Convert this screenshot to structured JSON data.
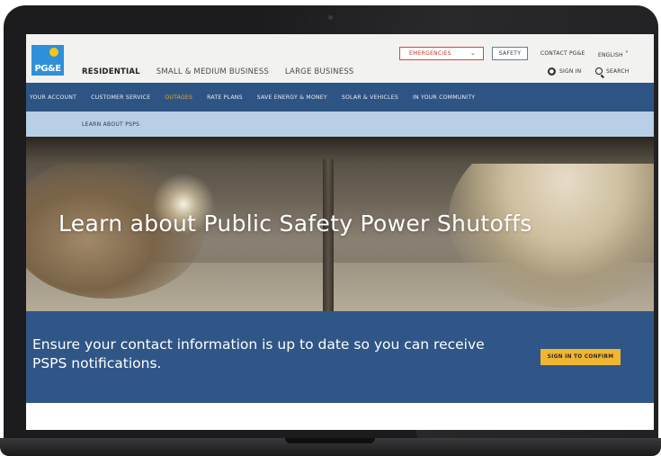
{
  "header": {
    "logo_text": "PG&E",
    "main_nav": [
      "RESIDENTIAL",
      "SMALL & MEDIUM BUSINESS",
      "LARGE BUSINESS"
    ],
    "active_main_nav": "RESIDENTIAL",
    "emergencies_label": "EMERGENCIES",
    "safety_label": "SAFETY",
    "contact_label": "CONTACT PG&E",
    "language_label": "ENGLISH",
    "sign_in_label": "SIGN IN",
    "search_label": "SEARCH"
  },
  "secondary_nav": {
    "items": [
      "YOUR ACCOUNT",
      "CUSTOMER SERVICE",
      "OUTAGES",
      "RATE PLANS",
      "SAVE ENERGY & MONEY",
      "SOLAR & VEHICLES",
      "IN YOUR COMMUNITY"
    ],
    "active": "OUTAGES"
  },
  "tertiary_nav": {
    "item": "LEARN ABOUT PSPS"
  },
  "hero": {
    "title": "Learn about Public Safety Power Shutoffs"
  },
  "banner": {
    "text": "Ensure your contact information is up to date so you can receive PSPS notifications.",
    "button_label": "SIGN IN TO CONFIRM"
  },
  "colors": {
    "nav_blue": "#2e5483",
    "banner_blue": "#2f5686",
    "light_blue_bar": "#b8cfe6",
    "accent_yellow": "#f0b531",
    "emergency_red": "#c0392b",
    "outages_active": "#e0a93a"
  }
}
